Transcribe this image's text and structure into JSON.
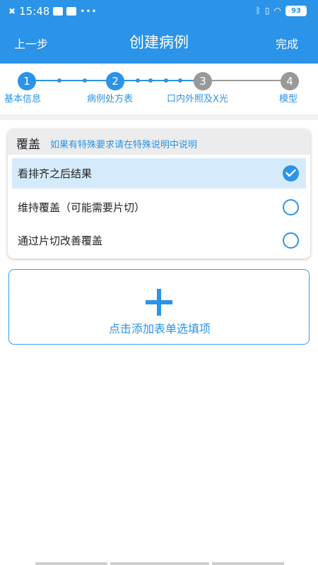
{
  "status_bar": {
    "time": "15:48",
    "dots": "•••",
    "battery": "93"
  },
  "nav": {
    "back": "上一步",
    "title": "创建病例",
    "done": "完成"
  },
  "steps": [
    {
      "number": "1",
      "label": "基本信息",
      "state": "done"
    },
    {
      "number": "2",
      "label": "病例处方表",
      "state": "active"
    },
    {
      "number": "3",
      "label": "口内外照及X光",
      "state": "pending"
    },
    {
      "number": "4",
      "label": "模型",
      "state": "pending"
    }
  ],
  "card": {
    "title": "覆盖",
    "hint": "如果有特殊要求请在特殊说明中说明",
    "options": [
      {
        "label": "看排齐之后结果",
        "selected": true
      },
      {
        "label": "维持覆盖（可能需要片切）",
        "selected": false
      },
      {
        "label": "通过片切改善覆盖",
        "selected": false
      }
    ]
  },
  "add_item": {
    "label": "点击添加表单选填项"
  },
  "colors": {
    "primary": "#2b93e8",
    "pending": "#999999",
    "selected_bg": "#d5ebfc"
  },
  "icons": {
    "check": "check-icon",
    "plus": "plus-icon"
  }
}
